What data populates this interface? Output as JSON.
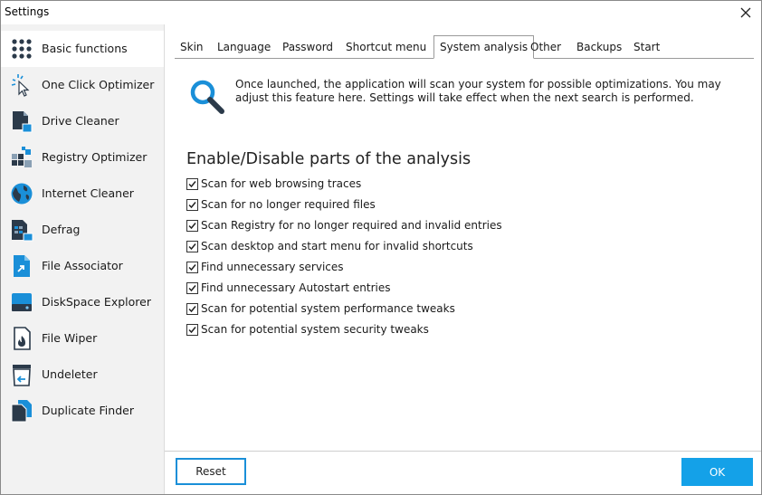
{
  "window": {
    "title": "Settings"
  },
  "sidebar": {
    "items": [
      {
        "label": "Basic functions",
        "icon": "grid-dots-icon",
        "selected": true
      },
      {
        "label": "One Click Optimizer",
        "icon": "cursor-click-icon"
      },
      {
        "label": "Drive Cleaner",
        "icon": "drive-cleaner-icon"
      },
      {
        "label": "Registry Optimizer",
        "icon": "registry-blocks-icon"
      },
      {
        "label": "Internet Cleaner",
        "icon": "globe-icon"
      },
      {
        "label": "Defrag",
        "icon": "defrag-icon"
      },
      {
        "label": "File Associator",
        "icon": "file-link-icon"
      },
      {
        "label": "DiskSpace Explorer",
        "icon": "disk-icon"
      },
      {
        "label": "File Wiper",
        "icon": "file-wiper-icon"
      },
      {
        "label": "Undeleter",
        "icon": "undelete-icon"
      },
      {
        "label": "Duplicate Finder",
        "icon": "duplicate-files-icon"
      }
    ]
  },
  "tabs": [
    {
      "label": "Skin"
    },
    {
      "label": "Language"
    },
    {
      "label": "Password"
    },
    {
      "label": "Shortcut menu"
    },
    {
      "label": "System analysis",
      "active": true
    },
    {
      "label": "Other"
    },
    {
      "label": "Backups"
    },
    {
      "label": "Start"
    }
  ],
  "main": {
    "info_text": "Once launched, the application will scan your system for possible optimizations. You may adjust this feature here. Settings will take effect when the next search is performed.",
    "section_title": "Enable/Disable parts of the analysis",
    "options": [
      {
        "label": "Scan for web browsing traces",
        "checked": true
      },
      {
        "label": "Scan for no longer required files",
        "checked": true
      },
      {
        "label": "Scan Registry for no longer required and invalid entries",
        "checked": true
      },
      {
        "label": "Scan desktop and start menu for invalid shortcuts",
        "checked": true
      },
      {
        "label": "Find unnecessary services",
        "checked": true
      },
      {
        "label": "Find unnecessary Autostart entries",
        "checked": true
      },
      {
        "label": "Scan for potential system performance tweaks",
        "checked": true
      },
      {
        "label": "Scan for potential system security tweaks",
        "checked": true
      }
    ]
  },
  "footer": {
    "reset_label": "Reset",
    "ok_label": "OK"
  },
  "colors": {
    "accent": "#14a1e8",
    "icon_dark": "#2b3a4a",
    "icon_blue": "#1a8fd8"
  }
}
